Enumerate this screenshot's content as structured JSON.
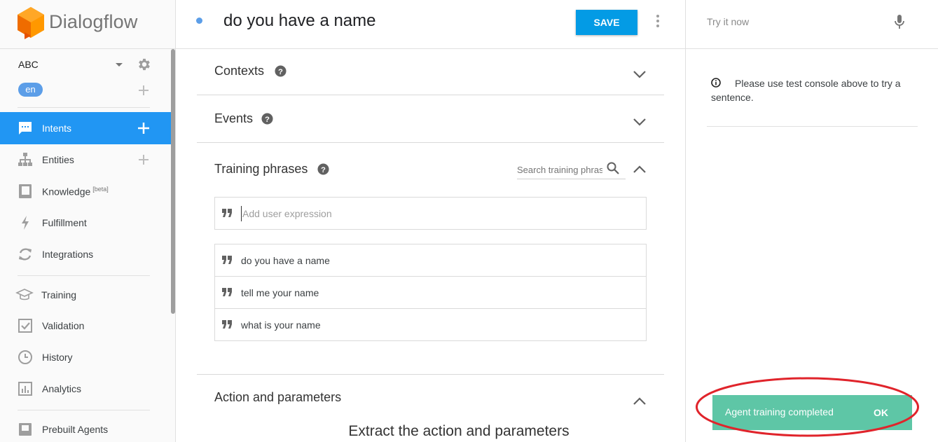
{
  "app": {
    "logo_text": "Dialogflow"
  },
  "agent": {
    "name": "ABC",
    "language": "en"
  },
  "sidebar": {
    "items": [
      {
        "label": "Intents",
        "icon": "chat-icon",
        "active": true
      },
      {
        "label": "Entities",
        "icon": "hierarchy-icon"
      },
      {
        "label": "Knowledge",
        "badge": "[beta]",
        "icon": "book-icon"
      },
      {
        "label": "Fulfillment",
        "icon": "bolt-icon"
      },
      {
        "label": "Integrations",
        "icon": "sync-icon"
      },
      {
        "label": "Training",
        "icon": "graduation-cap-icon"
      },
      {
        "label": "Validation",
        "icon": "checkbox-icon"
      },
      {
        "label": "History",
        "icon": "clock-icon"
      },
      {
        "label": "Analytics",
        "icon": "bar-chart-icon"
      },
      {
        "label": "Prebuilt Agents",
        "icon": "prebuilt-agents-icon"
      }
    ]
  },
  "header": {
    "title": "do you have a name",
    "save_label": "SAVE"
  },
  "sections": {
    "contexts": "Contexts",
    "events": "Events",
    "training": "Training phrases",
    "action": "Action and parameters"
  },
  "training": {
    "search_placeholder": "Search training phrases",
    "add_placeholder": "Add user expression",
    "phrases": [
      "do you have a name",
      "tell me your name",
      "what is your name"
    ]
  },
  "action": {
    "title": "Extract the action and parameters"
  },
  "test_console": {
    "placeholder": "Try it now",
    "info": "Please use test console above to try a sentence."
  },
  "toast": {
    "message": "Agent training completed",
    "action": "OK"
  },
  "colors": {
    "active_nav": "#2196f3",
    "save_button": "#039be5",
    "toast": "#5ec6a6",
    "annotation_ring": "#e0242b"
  }
}
